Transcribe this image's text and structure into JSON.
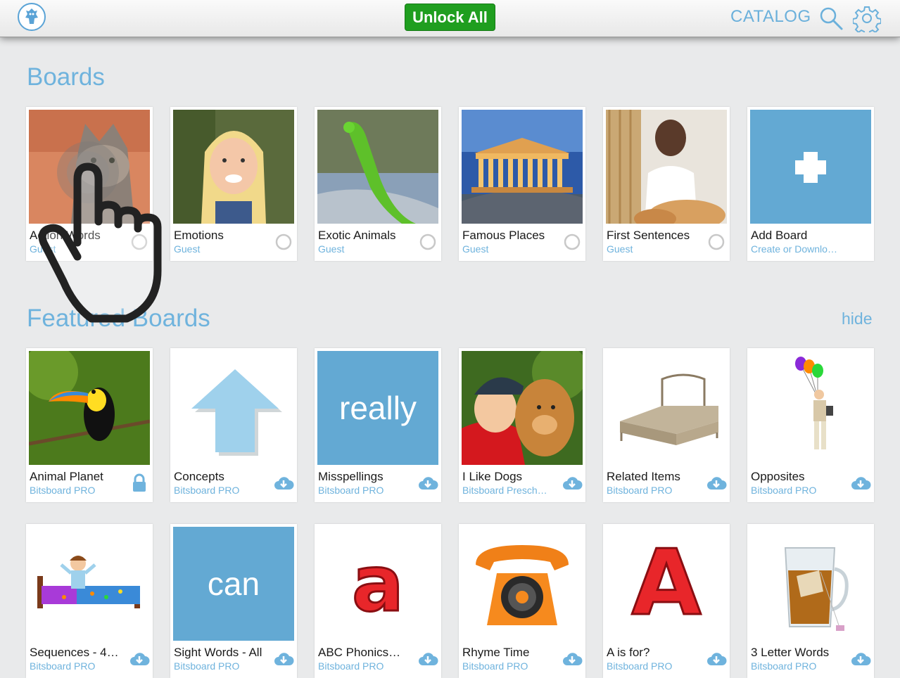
{
  "header": {
    "unlock_label": "Unlock All",
    "catalog_label": "CATALOG",
    "logo_icon": "bitsboard-owl-logo",
    "search_icon": "search-icon",
    "settings_icon": "gear-icon",
    "accent_color": "#6fb3dd",
    "unlock_color": "#1f9e1f"
  },
  "boards": {
    "title": "Boards",
    "items": [
      {
        "title": "Action Words",
        "subtitle": "Guest",
        "status": "radio"
      },
      {
        "title": "Emotions",
        "subtitle": "Guest",
        "status": "radio"
      },
      {
        "title": "Exotic Animals",
        "subtitle": "Guest",
        "status": "radio"
      },
      {
        "title": "Famous Places",
        "subtitle": "Guest",
        "status": "radio"
      },
      {
        "title": "First Sentences",
        "subtitle": "Guest",
        "status": "radio"
      },
      {
        "title": "Add Board",
        "subtitle": "Create or Downlo…",
        "status": "none"
      }
    ]
  },
  "featured": {
    "title": "Featured Boards",
    "hide_label": "hide",
    "row1": [
      {
        "title": "Animal Planet",
        "subtitle": "Bitsboard PRO",
        "status": "lock"
      },
      {
        "title": "Concepts",
        "subtitle": "Bitsboard PRO",
        "status": "download"
      },
      {
        "title": "Misspellings",
        "subtitle": "Bitsboard PRO",
        "status": "download",
        "tile_word": "really"
      },
      {
        "title": "I Like Dogs",
        "subtitle": "Bitsboard Presch…",
        "status": "download"
      },
      {
        "title": "Related Items",
        "subtitle": "Bitsboard PRO",
        "status": "download"
      },
      {
        "title": "Opposites",
        "subtitle": "Bitsboard PRO",
        "status": "download"
      }
    ],
    "row2": [
      {
        "title": "Sequences - 4…",
        "subtitle": "Bitsboard PRO",
        "status": "download"
      },
      {
        "title": "Sight Words - All",
        "subtitle": "Bitsboard PRO",
        "status": "download",
        "tile_word": "can"
      },
      {
        "title": "ABC Phonics…",
        "subtitle": "Bitsboard PRO",
        "status": "download",
        "tile_letter": "a"
      },
      {
        "title": "Rhyme Time",
        "subtitle": "Bitsboard PRO",
        "status": "download"
      },
      {
        "title": "A is for?",
        "subtitle": "Bitsboard PRO",
        "status": "download",
        "tile_letter": "A"
      },
      {
        "title": "3 Letter Words",
        "subtitle": "Bitsboard PRO",
        "status": "download"
      }
    ]
  }
}
